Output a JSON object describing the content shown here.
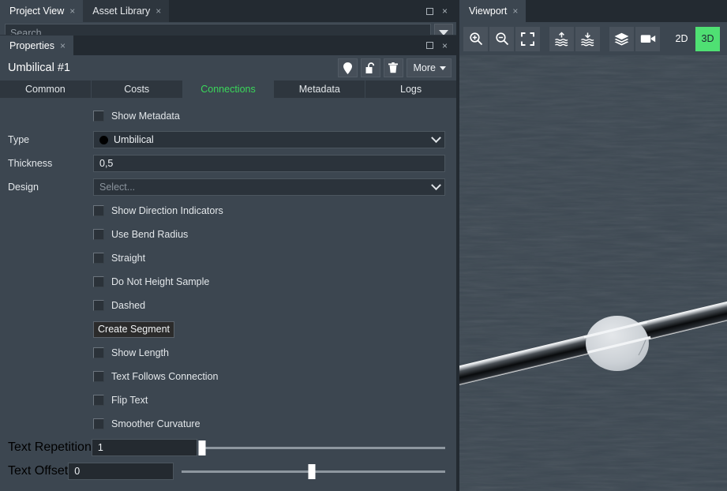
{
  "project_panel": {
    "tabs": [
      {
        "label": "Project View",
        "active": true,
        "close": "×"
      },
      {
        "label": "Asset Library",
        "active": false,
        "close": "×"
      }
    ],
    "window_buttons": {
      "restore": "restore-icon",
      "close": "×"
    },
    "search": {
      "placeholder": "Search",
      "value": "",
      "dropdown": "chevron-down-icon"
    }
  },
  "properties": {
    "tab": {
      "label": "Properties",
      "close": "×"
    },
    "window_buttons": {
      "restore": "restore-icon",
      "close": "×"
    },
    "title": "Umbilical #1",
    "title_buttons": [
      {
        "name": "pin-icon",
        "label": ""
      },
      {
        "name": "unlock-icon",
        "label": ""
      },
      {
        "name": "trash-icon",
        "label": ""
      }
    ],
    "more_label": "More",
    "segment_tabs": [
      {
        "label": "Common",
        "active": false
      },
      {
        "label": "Costs",
        "active": false
      },
      {
        "label": "Connections",
        "active": true
      },
      {
        "label": "Metadata",
        "active": false
      },
      {
        "label": "Logs",
        "active": false
      }
    ],
    "accent_color": "#3ad85a",
    "form": {
      "show_metadata": {
        "label": "Show Metadata",
        "checked": false
      },
      "type": {
        "label": "Type",
        "value": "Umbilical",
        "swatch_color": "#000000"
      },
      "thickness": {
        "label": "Thickness",
        "value": "0,5"
      },
      "design": {
        "label": "Design",
        "value": "",
        "placeholder": "Select..."
      },
      "checkboxes": [
        {
          "label": "Show Direction Indicators",
          "checked": false
        },
        {
          "label": "Use Bend Radius",
          "checked": false
        },
        {
          "label": "Straight",
          "checked": false
        },
        {
          "label": "Do Not Height Sample",
          "checked": false
        },
        {
          "label": "Dashed",
          "checked": false
        }
      ],
      "create_segment_label": "Create Segment",
      "checkboxes2": [
        {
          "label": "Show Length",
          "checked": false
        },
        {
          "label": "Text Follows Connection",
          "checked": false
        },
        {
          "label": "Flip Text",
          "checked": false
        },
        {
          "label": "Smoother Curvature",
          "checked": false
        }
      ],
      "text_repetition": {
        "label": "Text Repetition",
        "value": "1",
        "slider_percent": 0
      },
      "text_offset": {
        "label": "Text Offset",
        "value": "0",
        "slider_percent": 50
      }
    }
  },
  "viewport": {
    "tab": {
      "label": "Viewport",
      "close": "×"
    },
    "toolbar": [
      {
        "name": "zoom-in-icon",
        "label": "",
        "active": false
      },
      {
        "name": "zoom-out-icon",
        "label": "",
        "active": false
      },
      {
        "name": "fit-screen-icon",
        "label": "",
        "active": false
      },
      {
        "name": "above-water-icon",
        "label": "",
        "active": false
      },
      {
        "name": "below-water-icon",
        "label": "",
        "active": false
      },
      {
        "name": "layers-icon",
        "label": "",
        "active": false
      },
      {
        "name": "camera-icon",
        "label": "",
        "active": false
      },
      {
        "name": "view-2d-button",
        "label": "2D",
        "active": false
      },
      {
        "name": "view-3d-button",
        "label": "3D",
        "active": true
      }
    ],
    "scene": {
      "seabed_color": "#3d4852",
      "cable_name": "umbilical-cable",
      "node_name": "connection-node"
    }
  }
}
